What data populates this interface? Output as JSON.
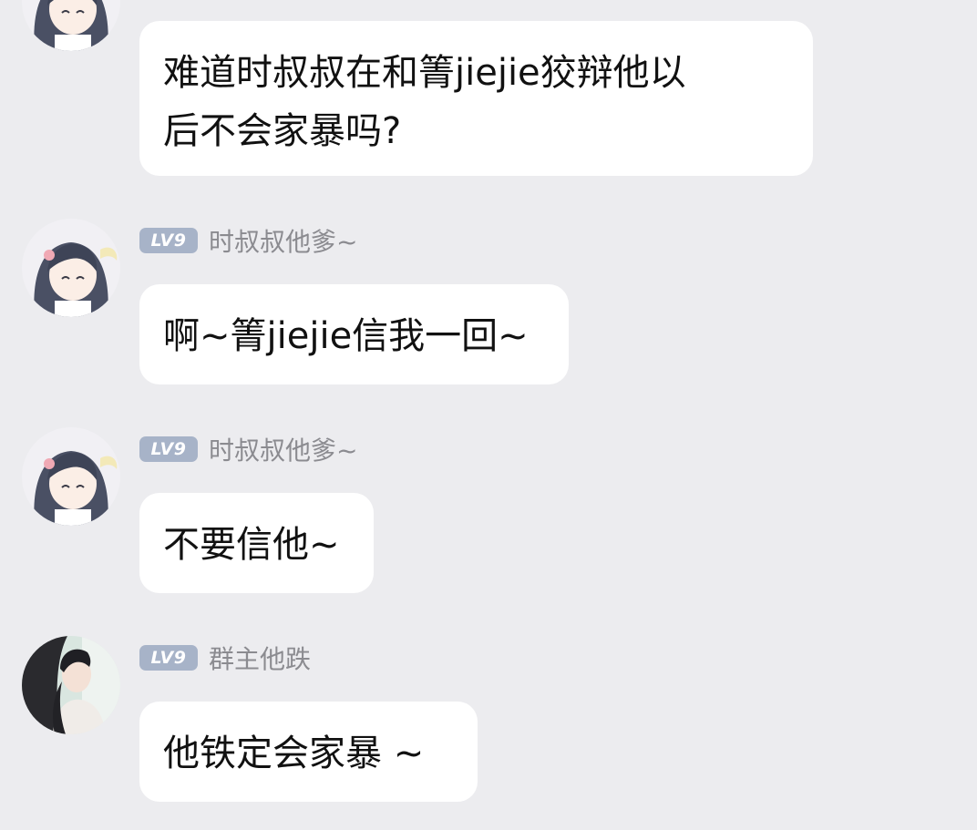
{
  "messages": [
    {
      "level": "",
      "nickname": "",
      "avatar": "anime-girl-dark-hair-avatar",
      "text_lines": [
        "难道时叔叔在和箐jiejie狡辩他以",
        "后不会家暴吗?"
      ]
    },
    {
      "level": "LV9",
      "nickname": "时叔叔他爹~",
      "avatar": "anime-girl-dark-hair-avatar",
      "text_lines": [
        "啊~箐jiejie信我一回~"
      ]
    },
    {
      "level": "LV9",
      "nickname": "时叔叔他爹~",
      "avatar": "anime-girl-dark-hair-avatar",
      "text_lines": [
        "不要信他~"
      ]
    },
    {
      "level": "LV9",
      "nickname": "群主他跌",
      "avatar": "photo-girl-long-hair-avatar",
      "text_lines": [
        "他铁定会家暴 ~"
      ]
    }
  ],
  "colors": {
    "background": "#ececef",
    "bubble": "#ffffff",
    "badge": "#a7b3c8",
    "nickname": "#8b8b90",
    "text": "#111111"
  }
}
